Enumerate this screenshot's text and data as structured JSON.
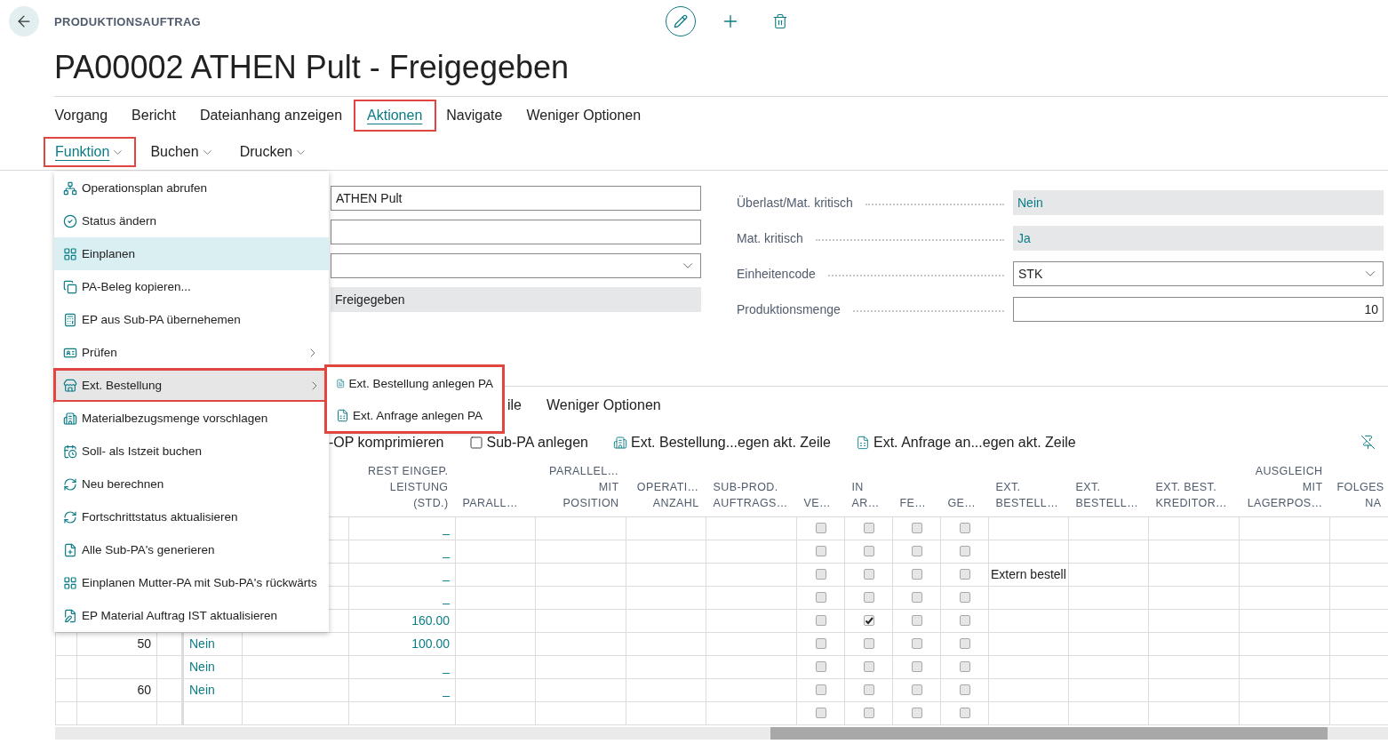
{
  "header": {
    "caption": "PRODUKTIONSAUFTRAG",
    "title": "PA00002 ATHEN Pult - Freigegeben"
  },
  "action_bar": {
    "groups": [
      [
        {
          "label": "Vorgang",
          "selected": false,
          "annotated": false
        },
        {
          "label": "Bericht",
          "selected": false,
          "annotated": false
        },
        {
          "label": "Dateianhang anzeigen",
          "selected": false,
          "annotated": false
        }
      ],
      [
        {
          "label": "Aktionen",
          "selected": true,
          "annotated": true
        },
        {
          "label": "Navigate",
          "selected": false,
          "annotated": false
        },
        {
          "label": "Weniger Optionen",
          "selected": false,
          "annotated": false
        }
      ]
    ]
  },
  "sub_bar": [
    {
      "label": "Funktion",
      "selected": true,
      "annotated": true
    },
    {
      "label": "Buchen",
      "selected": false,
      "annotated": false
    },
    {
      "label": "Drucken",
      "selected": false,
      "annotated": false
    }
  ],
  "form_left": [
    {
      "kind": "input",
      "value": "ATHEN Pult"
    },
    {
      "kind": "input"
    },
    {
      "kind": "select"
    },
    {
      "kind": "readonly",
      "value": "Freigegeben"
    }
  ],
  "form_right": [
    {
      "label": "Überlast/Mat. kritisch",
      "kind": "readonly",
      "value": "Nein"
    },
    {
      "label": "Mat. kritisch",
      "kind": "readonly",
      "value": "Ja"
    },
    {
      "label": "Einheitencode",
      "kind": "select",
      "value": "STK"
    },
    {
      "label": "Produktionsmenge",
      "kind": "number",
      "value": "10"
    }
  ],
  "subpage_toolbar": {
    "row_1": [
      "ile",
      "Weniger Optionen"
    ],
    "row_2": [
      "-OP komprimieren",
      "Sub-PA anlegen",
      "Ext. Bestellung...egen akt. Zeile",
      "Ext. Anfrage an...egen akt. Zeile"
    ]
  },
  "table": {
    "columns": [
      "REST EINGEP. LEISTUNG (STD.)",
      "PARALL…",
      "PARALLEL… MIT POSITION",
      "OPERATI… ANZAHL",
      "SUB-PROD. AUFTRAGS…",
      "VE…",
      "IN AR…",
      "FE…",
      "GE…",
      "EXT. BESTELL…",
      "EXT. BESTELL…",
      "EXT. BEST. KREDITOR…",
      "AUSGLEICH MIT LAGERPOS…",
      "FOLGES NA"
    ],
    "rows": [
      {
        "rest_eingep_leistung": "_",
        "checks": [
          false,
          false,
          false,
          false
        ]
      },
      {
        "rest_eingep_leistung": "_",
        "checks": [
          false,
          false,
          false,
          false
        ]
      },
      {
        "rest_eingep_leistung": "_",
        "ext_bestell": "Extern bestell",
        "checks": [
          false,
          false,
          false,
          false
        ]
      },
      {
        "rest_eingep_leistung": "_",
        "checks": [
          false,
          false,
          false,
          false
        ]
      },
      {
        "rest_eingep_leistung": "160.00",
        "checks": [
          false,
          true,
          false,
          false
        ]
      },
      {
        "column_2": "50",
        "column_4": "Nein",
        "rest_eingep_leistung": "100.00",
        "checks": [
          false,
          false,
          false,
          false
        ]
      },
      {
        "column_4": "Nein",
        "rest_eingep_leistung": "_",
        "checks": [
          false,
          false,
          false,
          false
        ]
      },
      {
        "column_2": "60",
        "column_4": "Nein",
        "rest_eingep_leistung": "_",
        "checks": [
          false,
          false,
          false,
          false
        ]
      },
      {
        "checks": [
          false,
          false,
          false,
          false
        ]
      }
    ]
  },
  "menu": {
    "items": [
      {
        "label": "Operationsplan abrufen",
        "has_submenu": false,
        "focused": false,
        "expanded": false,
        "annotated": false
      },
      {
        "label": "Status ändern",
        "has_submenu": false,
        "focused": false,
        "expanded": false,
        "annotated": false
      },
      {
        "label": "Einplanen",
        "has_submenu": false,
        "focused": true,
        "expanded": false,
        "annotated": false
      },
      {
        "label": "PA-Beleg kopieren...",
        "has_submenu": false,
        "focused": false,
        "expanded": false,
        "annotated": false
      },
      {
        "label": "EP aus Sub-PA übernehemen",
        "has_submenu": false,
        "focused": false,
        "expanded": false,
        "annotated": false
      },
      {
        "label": "Prüfen",
        "has_submenu": true,
        "focused": false,
        "expanded": false,
        "annotated": false
      },
      {
        "label": "Ext. Bestellung",
        "has_submenu": true,
        "focused": false,
        "expanded": true,
        "annotated": true
      },
      {
        "label": "Materialbezugsmenge vorschlagen",
        "has_submenu": false,
        "focused": false,
        "expanded": false,
        "annotated": false
      },
      {
        "label": "Soll- als Istzeit buchen",
        "has_submenu": false,
        "focused": false,
        "expanded": false,
        "annotated": false
      },
      {
        "label": "Neu berechnen",
        "has_submenu": false,
        "focused": false,
        "expanded": false,
        "annotated": false
      },
      {
        "label": "Fortschrittstatus aktualisieren",
        "has_submenu": false,
        "focused": false,
        "expanded": false,
        "annotated": false
      },
      {
        "label": "Alle Sub-PA's generieren",
        "has_submenu": false,
        "focused": false,
        "expanded": false,
        "annotated": false
      },
      {
        "label": "Einplanen Mutter-PA mit Sub-PA's rückwärts",
        "has_submenu": false,
        "focused": false,
        "expanded": false,
        "annotated": false
      },
      {
        "label": "EP Material Auftrag IST aktualisieren",
        "has_submenu": false,
        "focused": false,
        "expanded": false,
        "annotated": false
      }
    ]
  },
  "submenu": {
    "annotated": true,
    "items": [
      "Ext. Bestellung anlegen PA",
      "Ext. Anfrage anlegen PA"
    ]
  }
}
